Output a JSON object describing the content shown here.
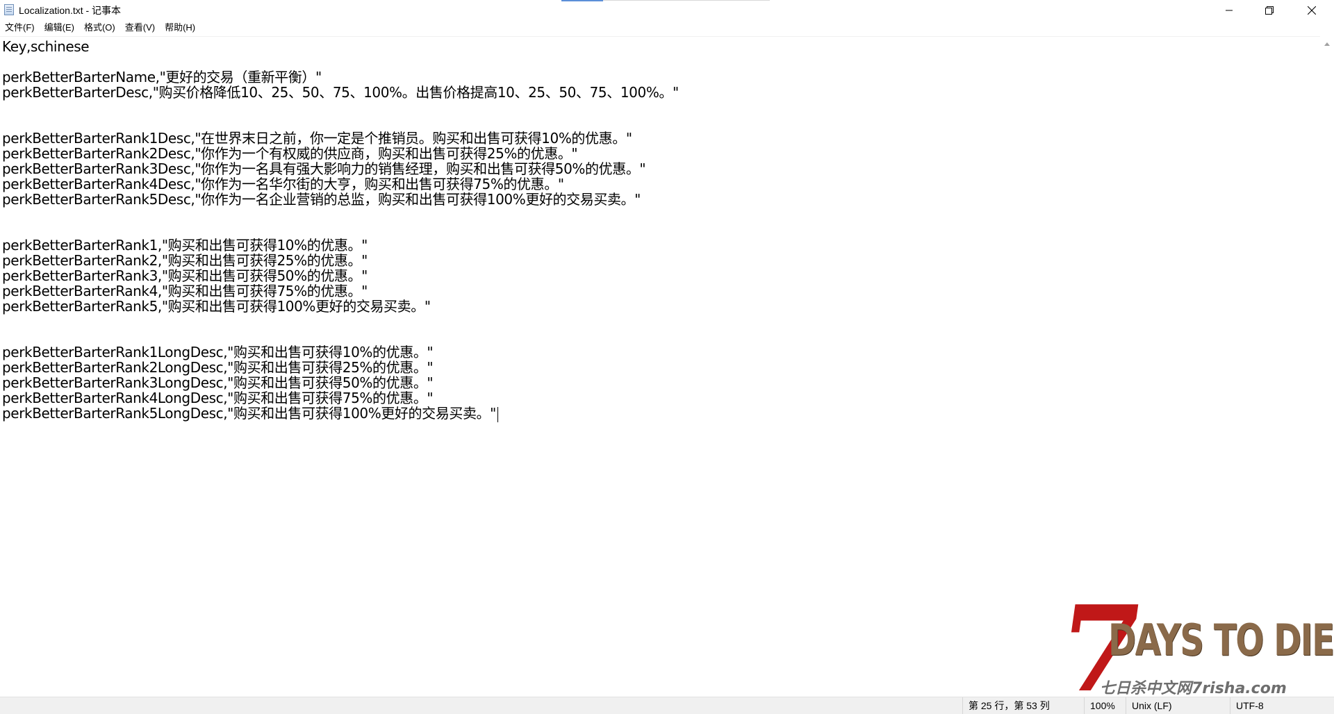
{
  "window": {
    "title": "Localization.txt - 记事本",
    "icon": "notepad-icon"
  },
  "menu": [
    "文件(F)",
    "编辑(E)",
    "格式(O)",
    "查看(V)",
    "帮助(H)"
  ],
  "editor": {
    "lines": [
      "Key,schinese",
      "",
      "perkBetterBarterName,\"更好的交易（重新平衡）\"",
      "perkBetterBarterDesc,\"购买价格降低10、25、50、75、100%。出售价格提高10、25、50、75、100%。\"",
      "",
      "",
      "perkBetterBarterRank1Desc,\"在世界末日之前，你一定是个推销员。购买和出售可获得10%的优惠。\"",
      "perkBetterBarterRank2Desc,\"你作为一个有权威的供应商，购买和出售可获得25%的优惠。\"",
      "perkBetterBarterRank3Desc,\"你作为一名具有强大影响力的销售经理，购买和出售可获得50%的优惠。\"",
      "perkBetterBarterRank4Desc,\"你作为一名华尔街的大亨，购买和出售可获得75%的优惠。\"",
      "perkBetterBarterRank5Desc,\"你作为一名企业营销的总监，购买和出售可获得100%更好的交易买卖。\"",
      "",
      "",
      "perkBetterBarterRank1,\"购买和出售可获得10%的优惠。\"",
      "perkBetterBarterRank2,\"购买和出售可获得25%的优惠。\"",
      "perkBetterBarterRank3,\"购买和出售可获得50%的优惠。\"",
      "perkBetterBarterRank4,\"购买和出售可获得75%的优惠。\"",
      "perkBetterBarterRank5,\"购买和出售可获得100%更好的交易买卖。\"",
      "",
      "",
      "perkBetterBarterRank1LongDesc,\"购买和出售可获得10%的优惠。\"",
      "perkBetterBarterRank2LongDesc,\"购买和出售可获得25%的优惠。\"",
      "perkBetterBarterRank3LongDesc,\"购买和出售可获得50%的优惠。\"",
      "perkBetterBarterRank4LongDesc,\"购买和出售可获得75%的优惠。\"",
      "perkBetterBarterRank5LongDesc,\"购买和出售可获得100%更好的交易买卖。\""
    ]
  },
  "status": {
    "position": "第 25 行，第 53 列",
    "zoom": "100%",
    "line_ending": "Unix (LF)",
    "encoding": "UTF-8"
  },
  "watermark": {
    "logo_number": "7",
    "logo_title": "DAYS TO DIE",
    "logo_subtitle": "七日杀中文网7risha.com"
  },
  "colors": {
    "statusbar_bg": "#f0f0f0",
    "logo_red": "#c01818",
    "logo_brown": "#8a6a4a"
  }
}
